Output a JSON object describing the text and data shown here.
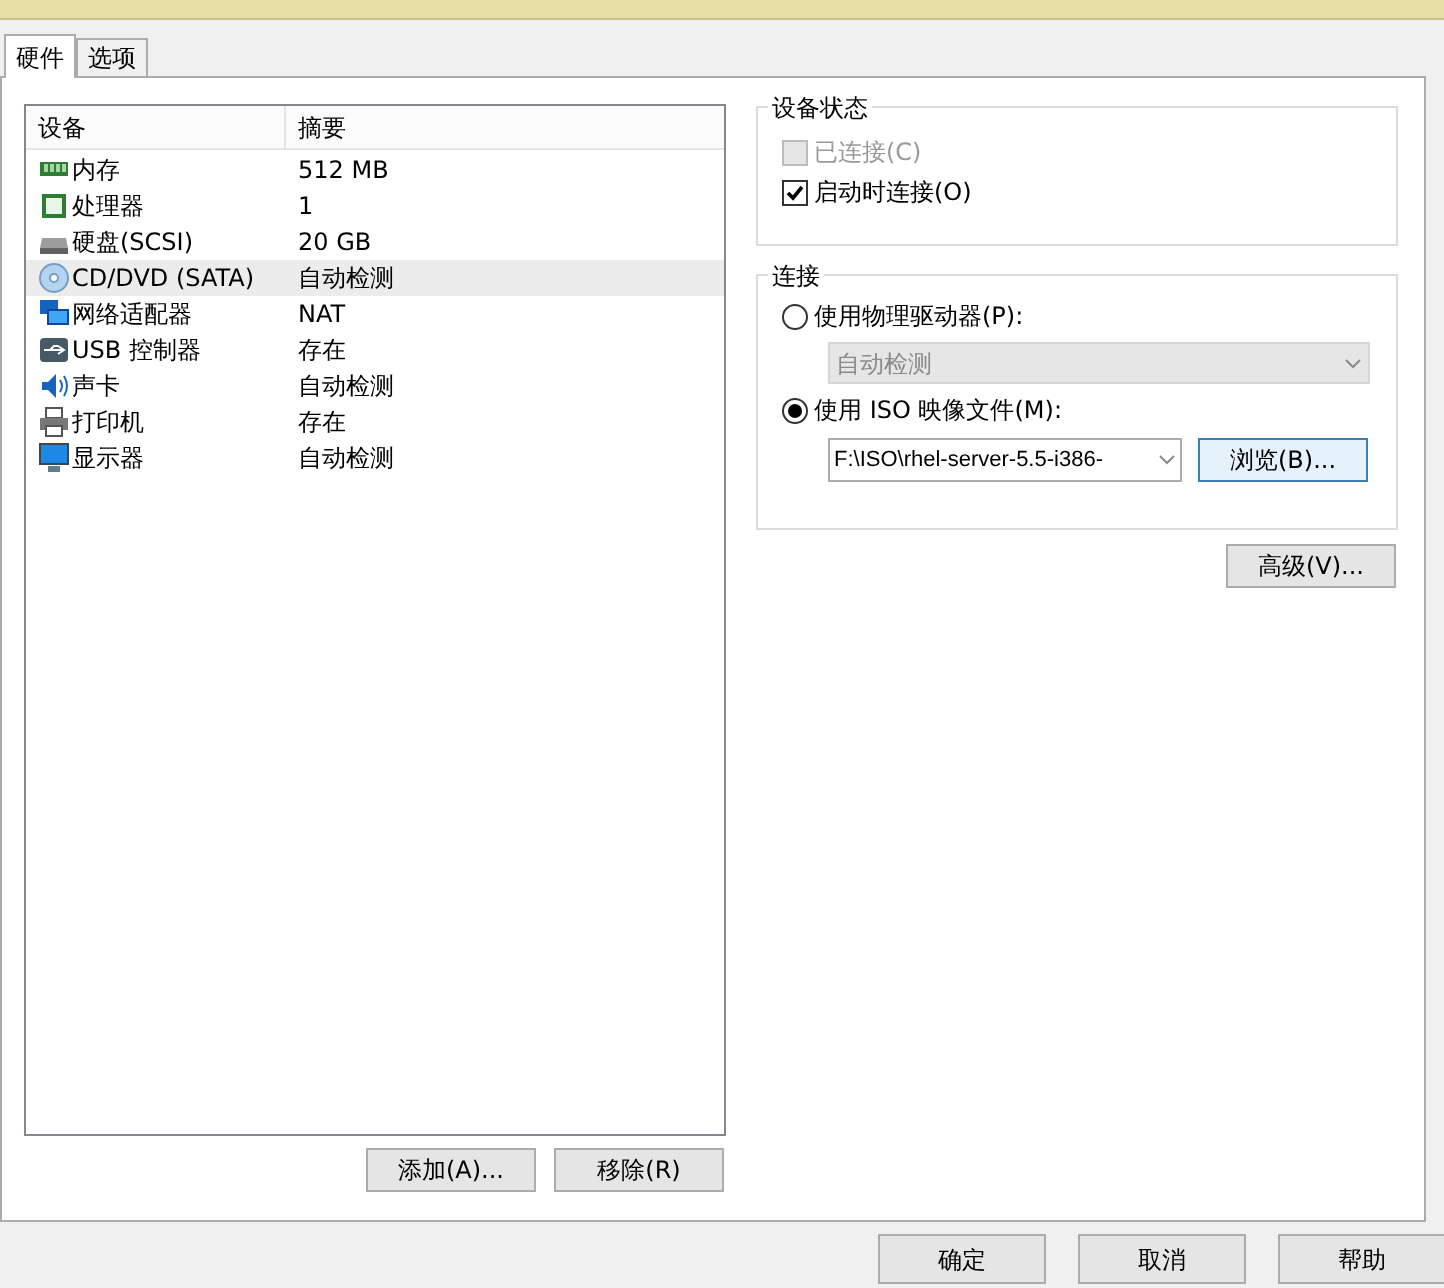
{
  "tabs": [
    {
      "label": "硬件",
      "selected": true
    },
    {
      "label": "选项",
      "selected": false
    }
  ],
  "device_list": {
    "columns": [
      "设备",
      "摘要"
    ],
    "rows": [
      {
        "kind": "memory",
        "device": "内存",
        "summary": "512 MB",
        "selected": false
      },
      {
        "kind": "cpu",
        "device": "处理器",
        "summary": "1",
        "selected": false
      },
      {
        "kind": "disk",
        "device": "硬盘(SCSI)",
        "summary": "20 GB",
        "selected": false
      },
      {
        "kind": "cdrom",
        "device": "CD/DVD (SATA)",
        "summary": "自动检测",
        "selected": true
      },
      {
        "kind": "network",
        "device": "网络适配器",
        "summary": "NAT",
        "selected": false
      },
      {
        "kind": "usb",
        "device": "USB 控制器",
        "summary": "存在",
        "selected": false
      },
      {
        "kind": "sound",
        "device": "声卡",
        "summary": "自动检测",
        "selected": false
      },
      {
        "kind": "printer",
        "device": "打印机",
        "summary": "存在",
        "selected": false
      },
      {
        "kind": "display",
        "device": "显示器",
        "summary": "自动检测",
        "selected": false
      }
    ],
    "buttons": [
      "添加(A)...",
      "移除(R)"
    ]
  },
  "device_status": {
    "title": "设备状态",
    "options": [
      {
        "label": "已连接(C)",
        "checked": false,
        "disabled": true
      },
      {
        "label": "启动时连接(O)",
        "checked": true,
        "disabled": false
      }
    ]
  },
  "connection": {
    "title": "连接",
    "physical": {
      "label": "使用物理驱动器(P):",
      "selected": false,
      "drive": {
        "value": "自动检测",
        "disabled": true
      }
    },
    "iso": {
      "label": "使用 ISO 映像文件(M):",
      "selected": true,
      "path": "F:\\ISO\\rhel-server-5.5-i386-",
      "browse": "浏览(B)..."
    }
  },
  "advanced_button": "高级(V)...",
  "dialog_buttons": [
    "确定",
    "取消",
    "帮助"
  ]
}
